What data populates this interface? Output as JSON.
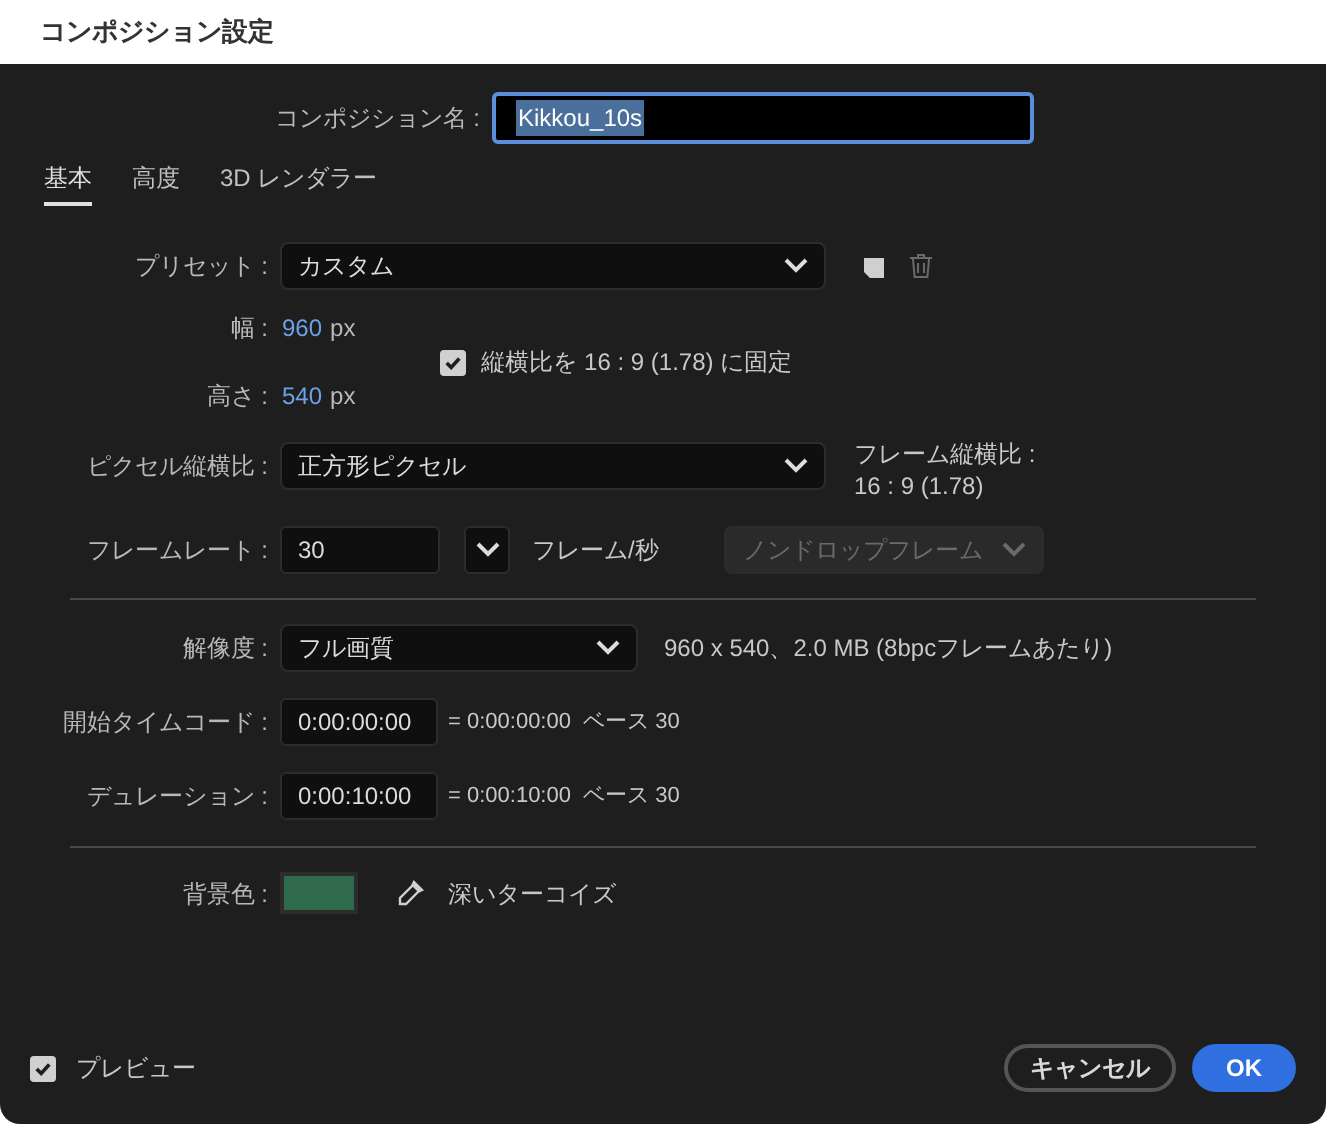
{
  "window": {
    "title": "コンポジション設定"
  },
  "composition_name": {
    "label": "コンポジション名 :",
    "value": "Kikkou_10s"
  },
  "tabs": [
    {
      "label": "基本",
      "selected": true
    },
    {
      "label": "高度",
      "selected": false
    },
    {
      "label": "3D レンダラー",
      "selected": false
    }
  ],
  "preset": {
    "label": "プリセット :",
    "value": "カスタム"
  },
  "width": {
    "label": "幅 :",
    "value": "960",
    "unit": "px"
  },
  "height": {
    "label": "高さ :",
    "value": "540",
    "unit": "px"
  },
  "lock_aspect": {
    "label": "縦横比を 16 : 9 (1.78) に固定",
    "checked": true
  },
  "pixel_aspect": {
    "label": "ピクセル縦横比 :",
    "value": "正方形ピクセル",
    "frame_aspect_label": "フレーム縦横比 :",
    "frame_aspect_value": "16 : 9 (1.78)"
  },
  "frame_rate": {
    "label": "フレームレート :",
    "value": "30",
    "unit": "フレーム/秒",
    "drop_frame": "ノンドロップフレーム",
    "drop_frame_disabled": true
  },
  "resolution": {
    "label": "解像度 :",
    "value": "フル画質",
    "info": "960 x 540、2.0 MB (8bpcフレームあたり)"
  },
  "start_timecode": {
    "label": "開始タイムコード :",
    "value": "0:00:00:00",
    "info": "= 0:00:00:00  ベース 30"
  },
  "duration": {
    "label": "デュレーション :",
    "value": "0:00:10:00",
    "info": "= 0:00:10:00  ベース 30"
  },
  "background": {
    "label": "背景色 :",
    "color": "#2f6a4c",
    "name": "深いターコイズ"
  },
  "preview": {
    "label": "プレビュー",
    "checked": true
  },
  "buttons": {
    "cancel": "キャンセル",
    "ok": "OK"
  }
}
